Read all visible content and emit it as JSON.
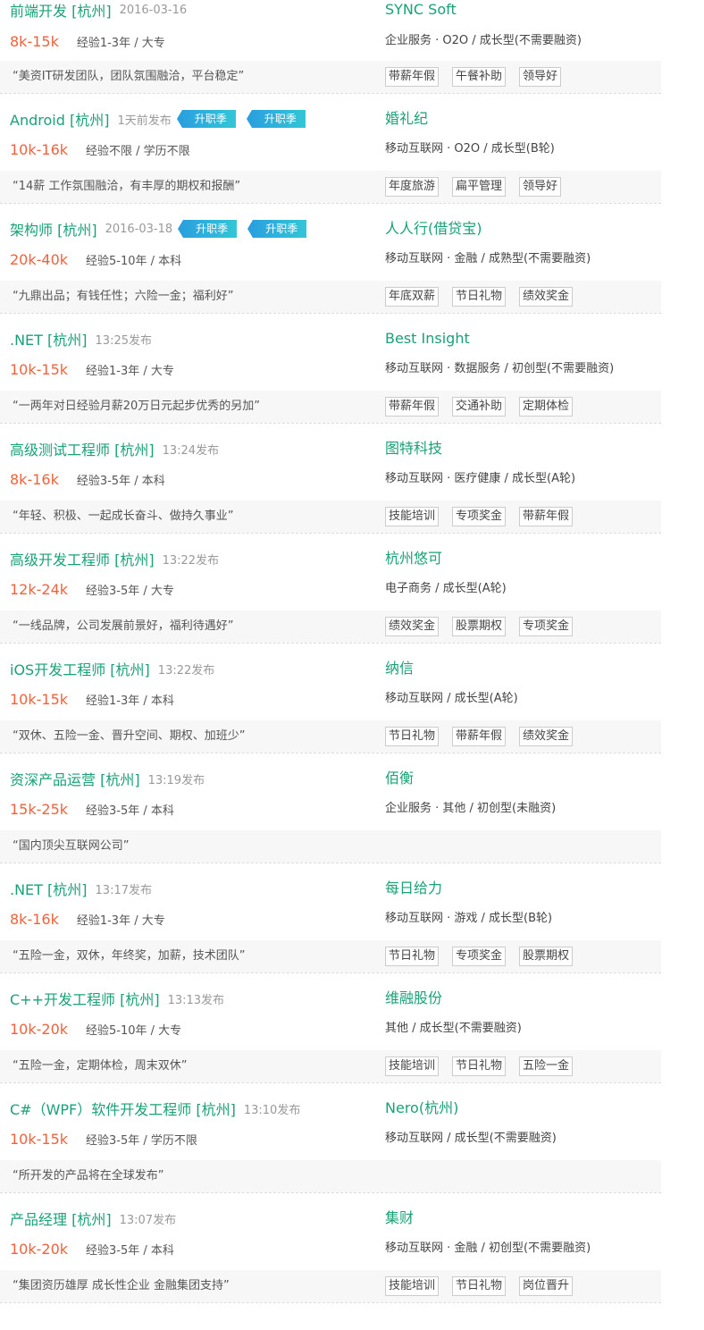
{
  "jobs": [
    {
      "title": "前端开发",
      "city": "[杭州]",
      "date": "2016-03-16",
      "badges": [],
      "salary": "8k-15k",
      "requirement": "经验1-3年 / 大专",
      "company": "SYNC Soft",
      "industry": "企业服务 · O2O / 成长型(不需要融资)",
      "slogan": "“美资IT研发团队，团队氛围融洽，平台稳定”",
      "tags": [
        "带薪年假",
        "午餐补助",
        "领导好"
      ]
    },
    {
      "title": "Android",
      "city": "[杭州]",
      "date": "1天前发布",
      "badges": [
        "升职季",
        "升职季"
      ],
      "salary": "10k-16k",
      "requirement": "经验不限 / 学历不限",
      "company": "婚礼纪",
      "industry": "移动互联网 · O2O / 成长型(B轮)",
      "slogan": "“14薪 工作氛围融洽，有丰厚的期权和报酬”",
      "tags": [
        "年度旅游",
        "扁平管理",
        "领导好"
      ]
    },
    {
      "title": "架构师",
      "city": "[杭州]",
      "date": "2016-03-18",
      "badges": [
        "升职季",
        "升职季"
      ],
      "salary": "20k-40k",
      "requirement": "经验5-10年 / 本科",
      "company": "人人行(借贷宝)",
      "industry": "移动互联网 · 金融 / 成熟型(不需要融资)",
      "slogan": "“九鼎出品；有钱任性；六险一金；福利好”",
      "tags": [
        "年底双薪",
        "节日礼物",
        "绩效奖金"
      ]
    },
    {
      "title": ".NET",
      "city": "[杭州]",
      "date": "13:25发布",
      "badges": [],
      "salary": "10k-15k",
      "requirement": "经验1-3年 / 大专",
      "company": "Best Insight",
      "industry": "移动互联网 · 数据服务 / 初创型(不需要融资)",
      "slogan": "“一两年对日经验月薪20万日元起步优秀的另加”",
      "tags": [
        "带薪年假",
        "交通补助",
        "定期体检"
      ]
    },
    {
      "title": "高级测试工程师",
      "city": "[杭州]",
      "date": "13:24发布",
      "badges": [],
      "salary": "8k-16k",
      "requirement": "经验3-5年 / 本科",
      "company": "图特科技",
      "industry": "移动互联网 · 医疗健康 / 成长型(A轮)",
      "slogan": "“年轻、积极、一起成长奋斗、做持久事业”",
      "tags": [
        "技能培训",
        "专项奖金",
        "带薪年假"
      ]
    },
    {
      "title": "高级开发工程师",
      "city": "[杭州]",
      "date": "13:22发布",
      "badges": [],
      "salary": "12k-24k",
      "requirement": "经验3-5年 / 大专",
      "company": "杭州悠可",
      "industry": "电子商务 / 成长型(A轮)",
      "slogan": "“一线品牌，公司发展前景好，福利待遇好”",
      "tags": [
        "绩效奖金",
        "股票期权",
        "专项奖金"
      ]
    },
    {
      "title": "iOS开发工程师",
      "city": "[杭州]",
      "date": "13:22发布",
      "badges": [],
      "salary": "10k-15k",
      "requirement": "经验1-3年 / 本科",
      "company": "纳信",
      "industry": "移动互联网 / 成长型(A轮)",
      "slogan": "“双休、五险一金、晋升空间、期权、加班少”",
      "tags": [
        "节日礼物",
        "带薪年假",
        "绩效奖金"
      ]
    },
    {
      "title": "资深产品运营",
      "city": "[杭州]",
      "date": "13:19发布",
      "badges": [],
      "salary": "15k-25k",
      "requirement": "经验3-5年 / 本科",
      "company": "佰衡",
      "industry": "企业服务 · 其他 / 初创型(未融资)",
      "slogan": "“国内顶尖互联网公司”",
      "tags": []
    },
    {
      "title": ".NET",
      "city": "[杭州]",
      "date": "13:17发布",
      "badges": [],
      "salary": "8k-16k",
      "requirement": "经验1-3年 / 大专",
      "company": "每日给力",
      "industry": "移动互联网 · 游戏 / 成长型(B轮)",
      "slogan": "“五险一金，双休，年终奖，加薪，技术团队”",
      "tags": [
        "节日礼物",
        "专项奖金",
        "股票期权"
      ]
    },
    {
      "title": "C++开发工程师",
      "city": "[杭州]",
      "date": "13:13发布",
      "badges": [],
      "salary": "10k-20k",
      "requirement": "经验5-10年 / 大专",
      "company": "维融股份",
      "industry": "其他 / 成长型(不需要融资)",
      "slogan": "“五险一金，定期体检，周末双休”",
      "tags": [
        "技能培训",
        "节日礼物",
        "五险一金"
      ]
    },
    {
      "title": "C#（WPF）软件开发工程师",
      "city": "[杭州]",
      "date": "13:10发布",
      "badges": [],
      "salary": "10k-15k",
      "requirement": "经验3-5年 / 学历不限",
      "company": "Nero(杭州)",
      "industry": "移动互联网 / 成长型(不需要融资)",
      "slogan": "“所开发的产品将在全球发布”",
      "tags": []
    },
    {
      "title": "产品经理",
      "city": "[杭州]",
      "date": "13:07发布",
      "badges": [],
      "salary": "10k-20k",
      "requirement": "经验3-5年 / 本科",
      "company": "集财",
      "industry": "移动互联网 · 金融 / 初创型(不需要融资)",
      "slogan": "“集团资历雄厚 成长性企业 金融集团支持”",
      "tags": [
        "技能培训",
        "节日礼物",
        "岗位晋升"
      ]
    }
  ]
}
